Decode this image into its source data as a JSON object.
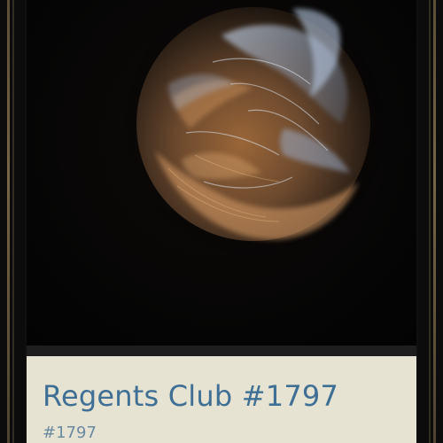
{
  "nft": {
    "title": "Regents Club #1797",
    "subtitle": "#1797"
  },
  "colors": {
    "frame_gold": "#8a7650",
    "caption_bg": "#e6e3d3",
    "title_blue": "#3f6f95",
    "subtitle_blue": "#6b8aa1",
    "orb_orange": "#d9905a",
    "orb_blue": "#9fb6d6"
  }
}
